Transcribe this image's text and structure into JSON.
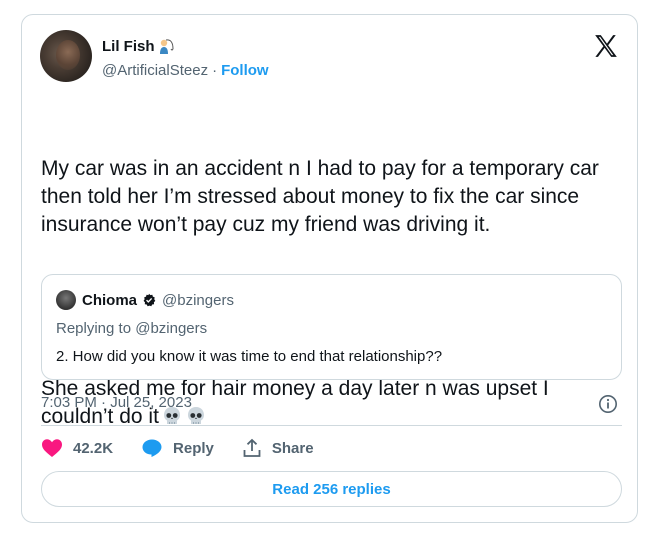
{
  "author": {
    "name": "Lil Fish",
    "name_emoji_icon": "fisherman-emoji-icon",
    "handle": "@ArtificialSteez",
    "separator": "·",
    "follow_label": "Follow"
  },
  "logo_icon": "x-logo-icon",
  "tweet": {
    "paragraph_1": "My car was in an accident n I had to pay for a temporary car then told her I’m stressed about money to fix the car since insurance won’t pay cuz my friend was driving it.",
    "paragraph_2": "She asked me for hair money a day later n was upset I couldn’t do it",
    "trailing_emoji_icons": [
      "skull-emoji-icon",
      "skull-emoji-icon"
    ]
  },
  "quoted_tweet": {
    "name": "Chioma",
    "badge_icon": "verified-badge-icon",
    "handle": "@bzingers",
    "replying_to": "Replying to @bzingers",
    "text": "2. How did you know it was time to end that relationship??"
  },
  "timestamp": "7:03 PM · Jul 25, 2023",
  "info_icon": "info-icon",
  "actions": {
    "like_count": "42.2K",
    "reply_label": "Reply",
    "share_label": "Share"
  },
  "read_replies_label": "Read 256 replies",
  "colors": {
    "accent": "#1d9bf0",
    "like": "#f91880",
    "muted_text": "#536471",
    "border": "#cfd9de"
  }
}
